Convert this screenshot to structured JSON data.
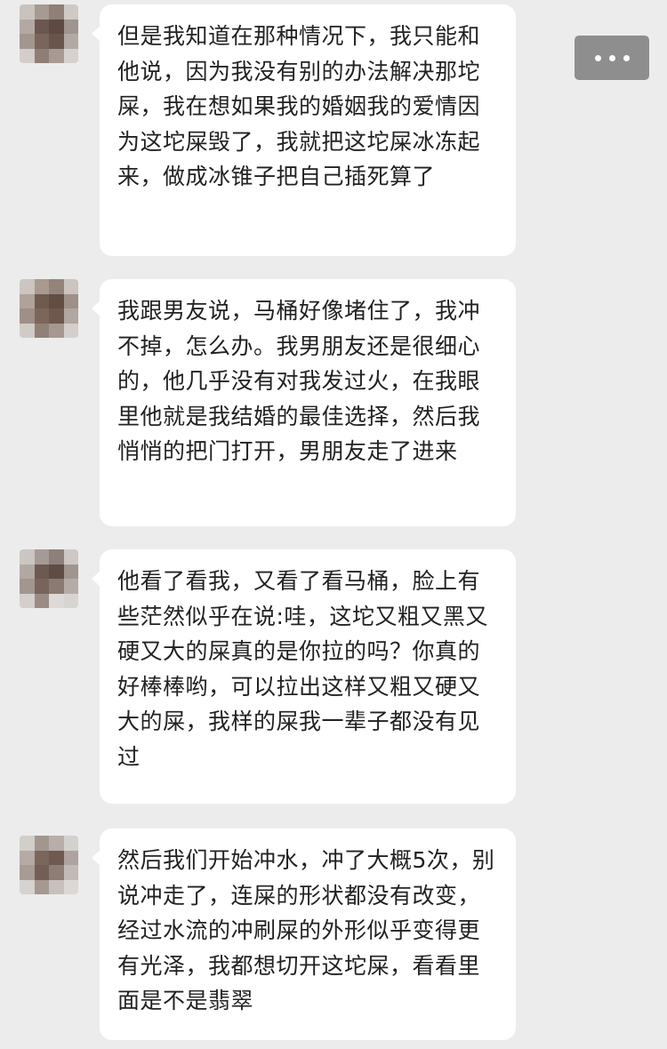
{
  "chat": {
    "messages": [
      {
        "sender": "contact",
        "text": "但是我知道在那种情况下，我只能和他说，因为我没有别的办法解决那坨屎，我在想如果我的婚姻我的爱情因为这坨屎毁了，我就把这坨屎冰冻起来，做成冰锥子把自己插死算了"
      },
      {
        "sender": "contact",
        "text": "我跟男友说，马桶好像堵住了，我冲不掉，怎么办。我男朋友还是很细心的，他几乎没有对我发过火，在我眼里他就是我结婚的最佳选择，然后我悄悄的把门打开，男朋友走了进来"
      },
      {
        "sender": "contact",
        "text": "他看了看我，又看了看马桶，脸上有些茫然似乎在说:哇，这坨又粗又黑又硬又大的屎真的是你拉的吗？你真的好棒棒哟，可以拉出这样又粗又硬又大的屎，我样的屎我一辈子都没有见过"
      },
      {
        "sender": "contact",
        "text": "然后我们开始冲水，冲了大概5次，别说冲走了，连屎的形状都没有改变，经过水流的冲刷屎的外形似乎变得更有光泽，我都想切开这坨屎，看看里面是不是翡翠"
      }
    ]
  },
  "header": {
    "more_icon": "more-dots-icon"
  },
  "colors": {
    "background": "#ececec",
    "bubble": "#ffffff",
    "text": "#222222",
    "more_button": "#8e8e8e"
  }
}
